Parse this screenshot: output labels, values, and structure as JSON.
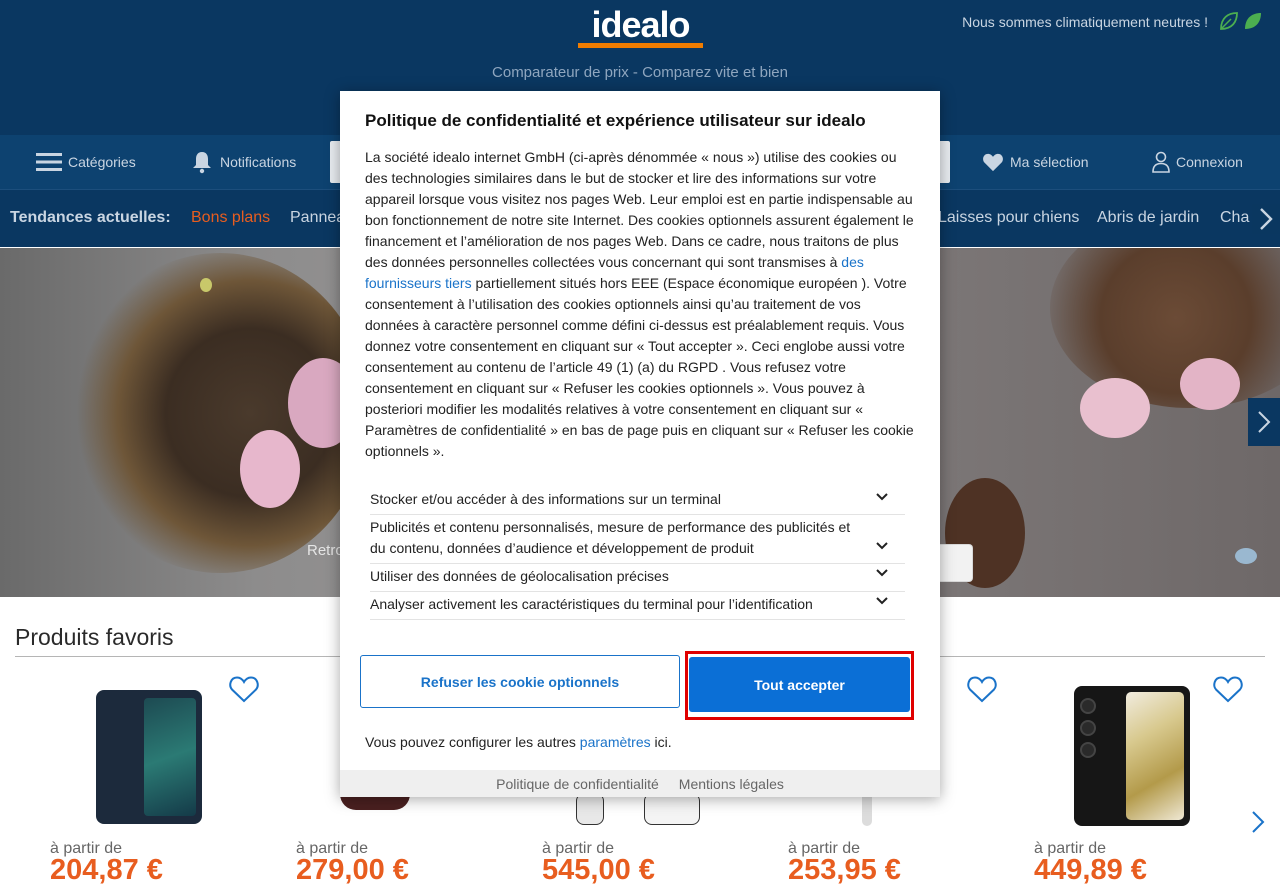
{
  "header": {
    "logo_text": "idealo",
    "tagline": "Comparateur de prix - Comparez vite et bien",
    "climate_text": "Nous sommes climatiquement neutres !"
  },
  "nav": {
    "categories": "Catégories",
    "notifications": "Notifications",
    "selection": "Ma sélection",
    "login": "Connexion"
  },
  "trends": {
    "label": "Tendances actuelles:",
    "items": [
      "Bons plans",
      "Pannea",
      "Laisses pour chiens",
      "Abris de jardin",
      "Cha"
    ]
  },
  "hero": {
    "caption": "Retro"
  },
  "favorites": {
    "title": "Produits favoris",
    "products": [
      {
        "from": "à partir de",
        "price": "204,87 €"
      },
      {
        "from": "à partir de",
        "price": "279,00 €"
      },
      {
        "from": "à partir de",
        "price": "545,00 €"
      },
      {
        "from": "à partir de",
        "price": "253,95 €"
      },
      {
        "from": "à partir de",
        "price": "449,89 €"
      }
    ]
  },
  "modal": {
    "title": "Politique de confidentialité et expérience utilisateur sur idealo",
    "body_part1": "La société idealo internet GmbH (ci-après dénommée « nous ») utilise des cookies ou des technologies similaires dans le but de stocker et lire des informations sur votre appareil lorsque vous visitez nos pages Web. Leur emploi est en partie indispensable au bon fonctionnement de notre site Internet. Des cookies optionnels assurent également le financement et l’amélioration de nos pages Web. Dans ce cadre, nous traitons de plus des données personnelles collectées vous concernant qui sont transmises à ",
    "body_link": "des fournisseurs tiers",
    "body_part2": " partiellement situés hors EEE (Espace économique européen ). Votre consentement à l’utilisation des cookies optionnels ainsi qu’au traitement de vos données à caractère personnel comme défini ci-dessus est préalablement requis. Vous donnez votre consentement en cliquant sur « Tout accepter ». Ceci englobe aussi votre consentement au contenu de l’article 49 (1) (a) du RGPD . Vous refusez votre consentement en cliquant sur « Refuser les cookies optionnels ». Vous pouvez à posteriori modifier les modalités relatives à votre consentement en cliquant sur « Paramètres de confidentialité » en bas de page puis en cliquant sur « Refuser les cookie optionnels ».",
    "accordions": [
      "Stocker et/ou accéder à des informations sur un terminal",
      "Publicités et contenu personnalisés, mesure de performance des publicités et du contenu, données d’audience et développement de produit",
      "Utiliser des données de géolocalisation précises",
      "Analyser activement les caractéristiques du terminal pour l’identification"
    ],
    "refuse_label": "Refuser les cookie optionnels",
    "accept_label": "Tout accepter",
    "config_prefix": "Vous pouvez configurer les autres ",
    "config_link": "paramètres",
    "config_suffix": " ici.",
    "footer_privacy": "Politique de confidentialité",
    "footer_legal": "Mentions légales"
  },
  "colors": {
    "header_bg": "#0a3761",
    "accent_orange": "#e85d1f",
    "primary_blue": "#0b6fd6",
    "highlight_red": "#e00000"
  }
}
